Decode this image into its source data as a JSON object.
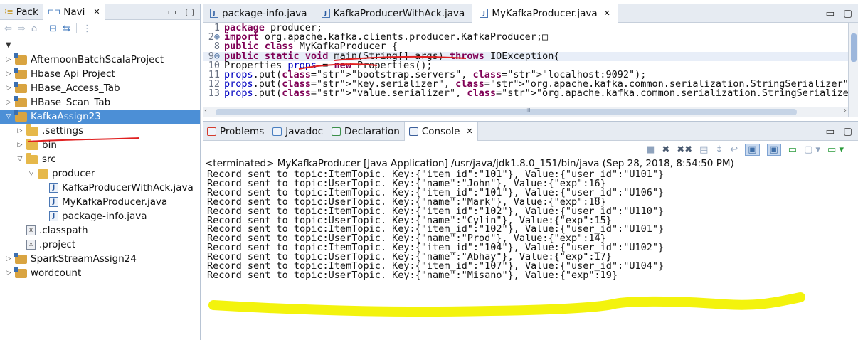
{
  "left_panel": {
    "tabs": [
      {
        "label": "Pack",
        "icon": "package-explorer-icon"
      },
      {
        "label": "Navi",
        "icon": "navigator-icon",
        "close": "✕"
      }
    ],
    "tree": [
      {
        "label": "AfternoonBatchScalaProject",
        "icon": "project-icon",
        "twisty": "▷",
        "level": 0
      },
      {
        "label": "Hbase Api Project",
        "icon": "project-icon",
        "twisty": "▷",
        "level": 0
      },
      {
        "label": "HBase_Access_Tab",
        "icon": "project-icon",
        "twisty": "▷",
        "level": 0
      },
      {
        "label": "HBase_Scan_Tab",
        "icon": "project-icon",
        "twisty": "▷",
        "level": 0
      },
      {
        "label": "KafkaAssign23",
        "icon": "project-icon",
        "twisty": "▽",
        "level": 0,
        "selected": true
      },
      {
        "label": ".settings",
        "icon": "folder-icon",
        "twisty": "▷",
        "level": 1
      },
      {
        "label": "bin",
        "icon": "folder-icon",
        "twisty": "▷",
        "level": 1
      },
      {
        "label": "src",
        "icon": "folder-icon",
        "twisty": "▽",
        "level": 1
      },
      {
        "label": "producer",
        "icon": "package-icon",
        "twisty": "▽",
        "level": 2
      },
      {
        "label": "KafkaProducerWithAck.java",
        "icon": "java-file-icon",
        "twisty": "",
        "level": 3
      },
      {
        "label": "MyKafkaProducer.java",
        "icon": "java-file-icon",
        "twisty": "",
        "level": 3
      },
      {
        "label": "package-info.java",
        "icon": "java-file-icon",
        "twisty": "",
        "level": 3
      },
      {
        "label": ".classpath",
        "icon": "xml-file-icon",
        "twisty": "",
        "level": 1
      },
      {
        "label": ".project",
        "icon": "xml-file-icon",
        "twisty": "",
        "level": 1
      },
      {
        "label": "SparkStreamAssign24",
        "icon": "project-icon",
        "twisty": "▷",
        "level": 0
      },
      {
        "label": "wordcount",
        "icon": "project-icon",
        "twisty": "▷",
        "level": 0
      }
    ]
  },
  "editor": {
    "tabs": [
      {
        "label": "package-info.java",
        "active": false
      },
      {
        "label": "KafkaProducerWithAck.java",
        "active": false
      },
      {
        "label": "MyKafkaProducer.java",
        "active": true,
        "close": "✕"
      }
    ],
    "lines": [
      {
        "num": "1",
        "marker": "",
        "text": "package producer;"
      },
      {
        "num": "2",
        "marker": "⊕",
        "text": "import org.apache.kafka.clients.producer.KafkaProducer;□"
      },
      {
        "num": "8",
        "marker": "",
        "text": "public class MyKafkaProducer {"
      },
      {
        "num": "9",
        "marker": "⊖",
        "text": "public static void main(String[] args) throws IOException{"
      },
      {
        "num": "10",
        "marker": "",
        "text": "Properties props = new Properties();"
      },
      {
        "num": "11",
        "marker": "",
        "text": "props.put(\"bootstrap.servers\", \"localhost:9092\");"
      },
      {
        "num": "12",
        "marker": "",
        "text": "props.put(\"key.serializer\", \"org.apache.kafka.common.serialization.StringSerializer\");"
      },
      {
        "num": "13",
        "marker": "",
        "text": "props.put(\"value.serializer\", \"org.apache.kafka.common.serialization.StringSerializer\");"
      }
    ],
    "hscroll_mark": "III"
  },
  "console": {
    "tabs": [
      {
        "label": "Problems",
        "icon": "problems-icon"
      },
      {
        "label": "Javadoc",
        "icon": "javadoc-icon"
      },
      {
        "label": "Declaration",
        "icon": "declaration-icon"
      },
      {
        "label": "Console",
        "icon": "console-icon",
        "close": "✕",
        "active": true
      }
    ],
    "terminated": "<terminated> MyKafkaProducer [Java Application] /usr/java/jdk1.8.0_151/bin/java (Sep 28, 2018, 8:54:50 PM)",
    "output": [
      "Record sent to topic:ItemTopic. Key:{\"item_id\":\"101\"}, Value:{\"user_id\":\"U101\"}",
      "Record sent to topic:UserTopic. Key:{\"name\":\"John\"}, Value:{\"exp\":16}",
      "Record sent to topic:ItemTopic. Key:{\"item_id\":\"101\"}, Value:{\"user_id\":\"U106\"}",
      "Record sent to topic:UserTopic. Key:{\"name\":\"Mark\"}, Value:{\"exp\":18}",
      "Record sent to topic:ItemTopic. Key:{\"item_id\":\"102\"}, Value:{\"user_id\":\"U110\"}",
      "Record sent to topic:UserTopic. Key:{\"name\":\"Cylin\"}, Value:{\"exp\":15}",
      "Record sent to topic:ItemTopic. Key:{\"item_id\":\"102\"}, Value:{\"user_id\":\"U101\"}",
      "Record sent to topic:UserTopic. Key:{\"name\":\"Prod\"}, Value:{\"exp\":14}",
      "Record sent to topic:ItemTopic. Key:{\"item_id\":\"104\"}, Value:{\"user_id\":\"U102\"}",
      "Record sent to topic:UserTopic. Key:{\"name\":\"Abhay\"}, Value:{\"exp\":17}",
      "Record sent to topic:ItemTopic. Key:{\"item_id\":\"107\"}, Value:{\"user_id\":\"U104\"}",
      "Record sent to topic:UserTopic. Key:{\"name\":\"Misano\"}, Value:{\"exp\":19}"
    ]
  },
  "colors": {
    "selection": "#4c8fd6",
    "highlighter": "#f2f200",
    "annotation_red": "#e02020",
    "keyword": "#7f0055",
    "string": "#2a00ff"
  }
}
